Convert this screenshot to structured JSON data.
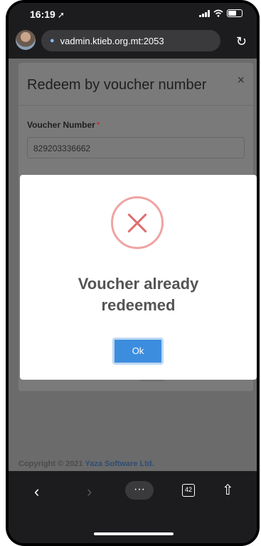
{
  "status_bar": {
    "time": "16:19",
    "location_glyph": "➚"
  },
  "browser": {
    "url": "vadmin.ktieb.org.mt:2053",
    "tabs_count": "42"
  },
  "modal": {
    "title": "Redeem by voucher number",
    "close_label": "×",
    "field_label": "Voucher Number",
    "required_mark": "*",
    "field_value": "829203336662"
  },
  "footer": {
    "copyright_prefix": "Copyright © 2021",
    "company": "Yaza Software Ltd."
  },
  "alert": {
    "icon": "error-x-icon",
    "message": "Voucher already redeemed",
    "ok_label": "Ok",
    "accent_color": "#3c8dde",
    "error_color": "#e06d6d"
  }
}
